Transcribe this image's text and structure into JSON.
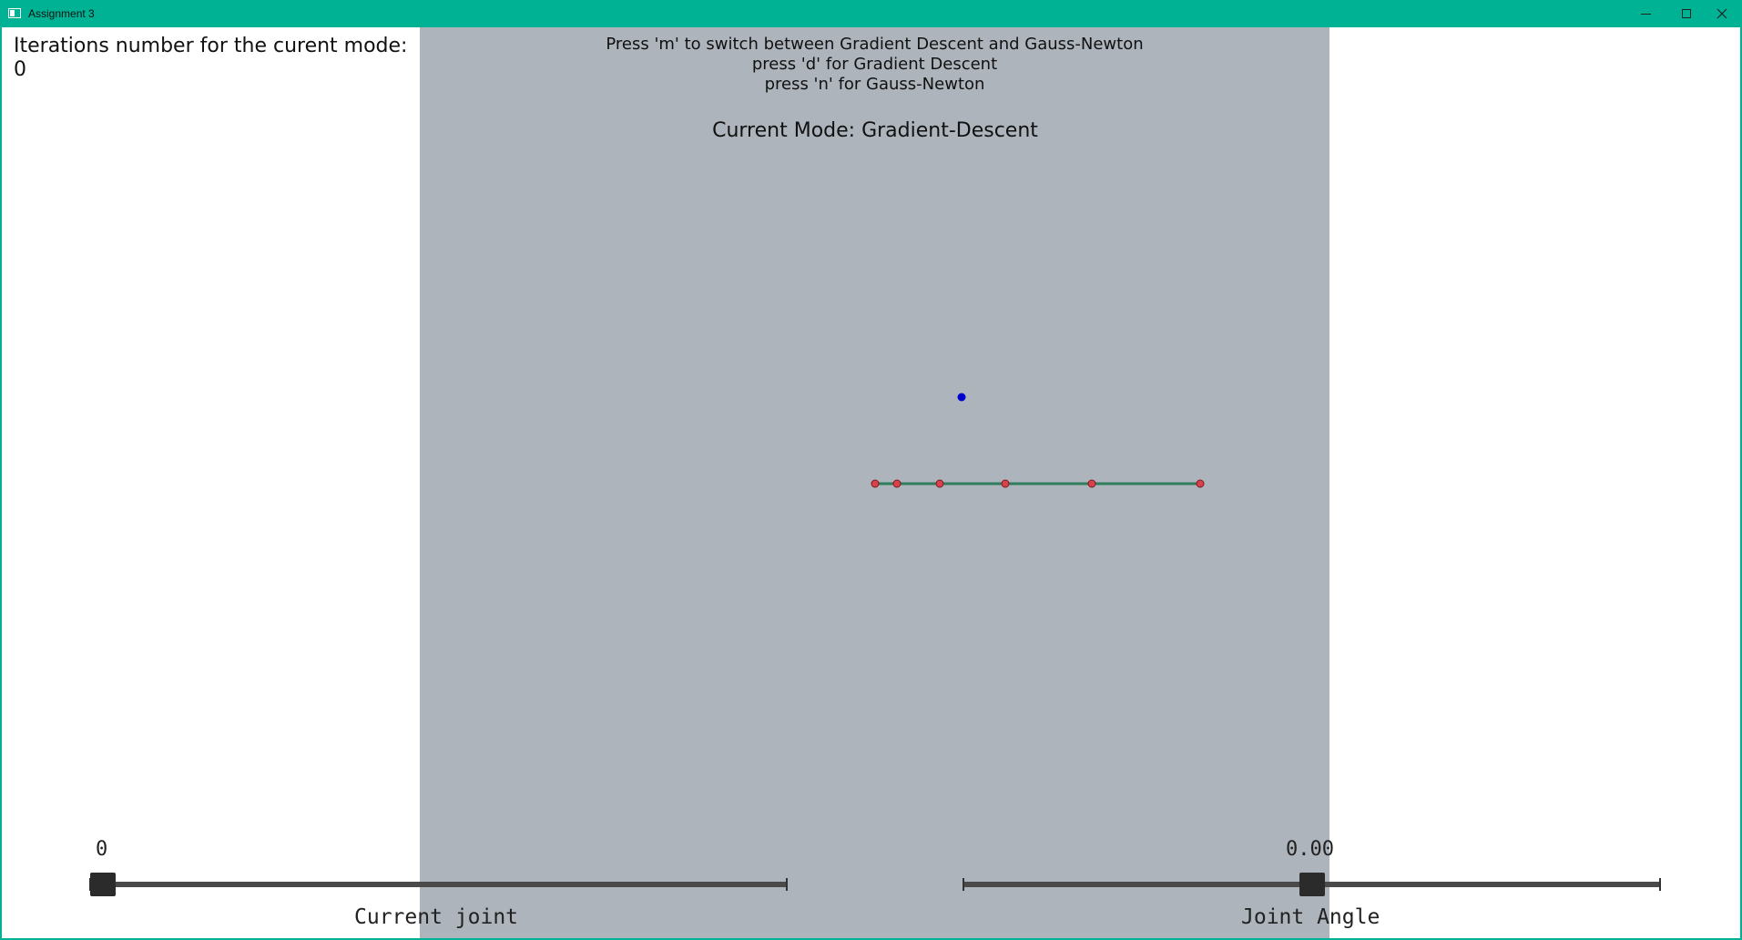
{
  "window": {
    "title": "Assignment 3",
    "accent_color": "#00b294"
  },
  "info": {
    "iterations_label": "Iterations number for the curent mode:",
    "iterations_value": "0"
  },
  "instructions": {
    "line1": "Press 'm' to switch between Gradient Descent and Gauss-Newton",
    "line2": "press 'd' for Gradient Descent",
    "line3": "press 'n' for Gauss-Newton"
  },
  "mode": {
    "label": "Current Mode: Gradient-Descent"
  },
  "scene": {
    "background_color": "#adb4bb",
    "link_color": "#2e7d5b",
    "joint_color": "#d9414b",
    "target_color": "#0000cc"
  },
  "sliders": {
    "current_joint": {
      "value": "0",
      "caption": "Current joint",
      "fraction": 0.0
    },
    "joint_angle": {
      "value": "0.00",
      "caption": "Joint Angle",
      "fraction": 0.5
    }
  }
}
